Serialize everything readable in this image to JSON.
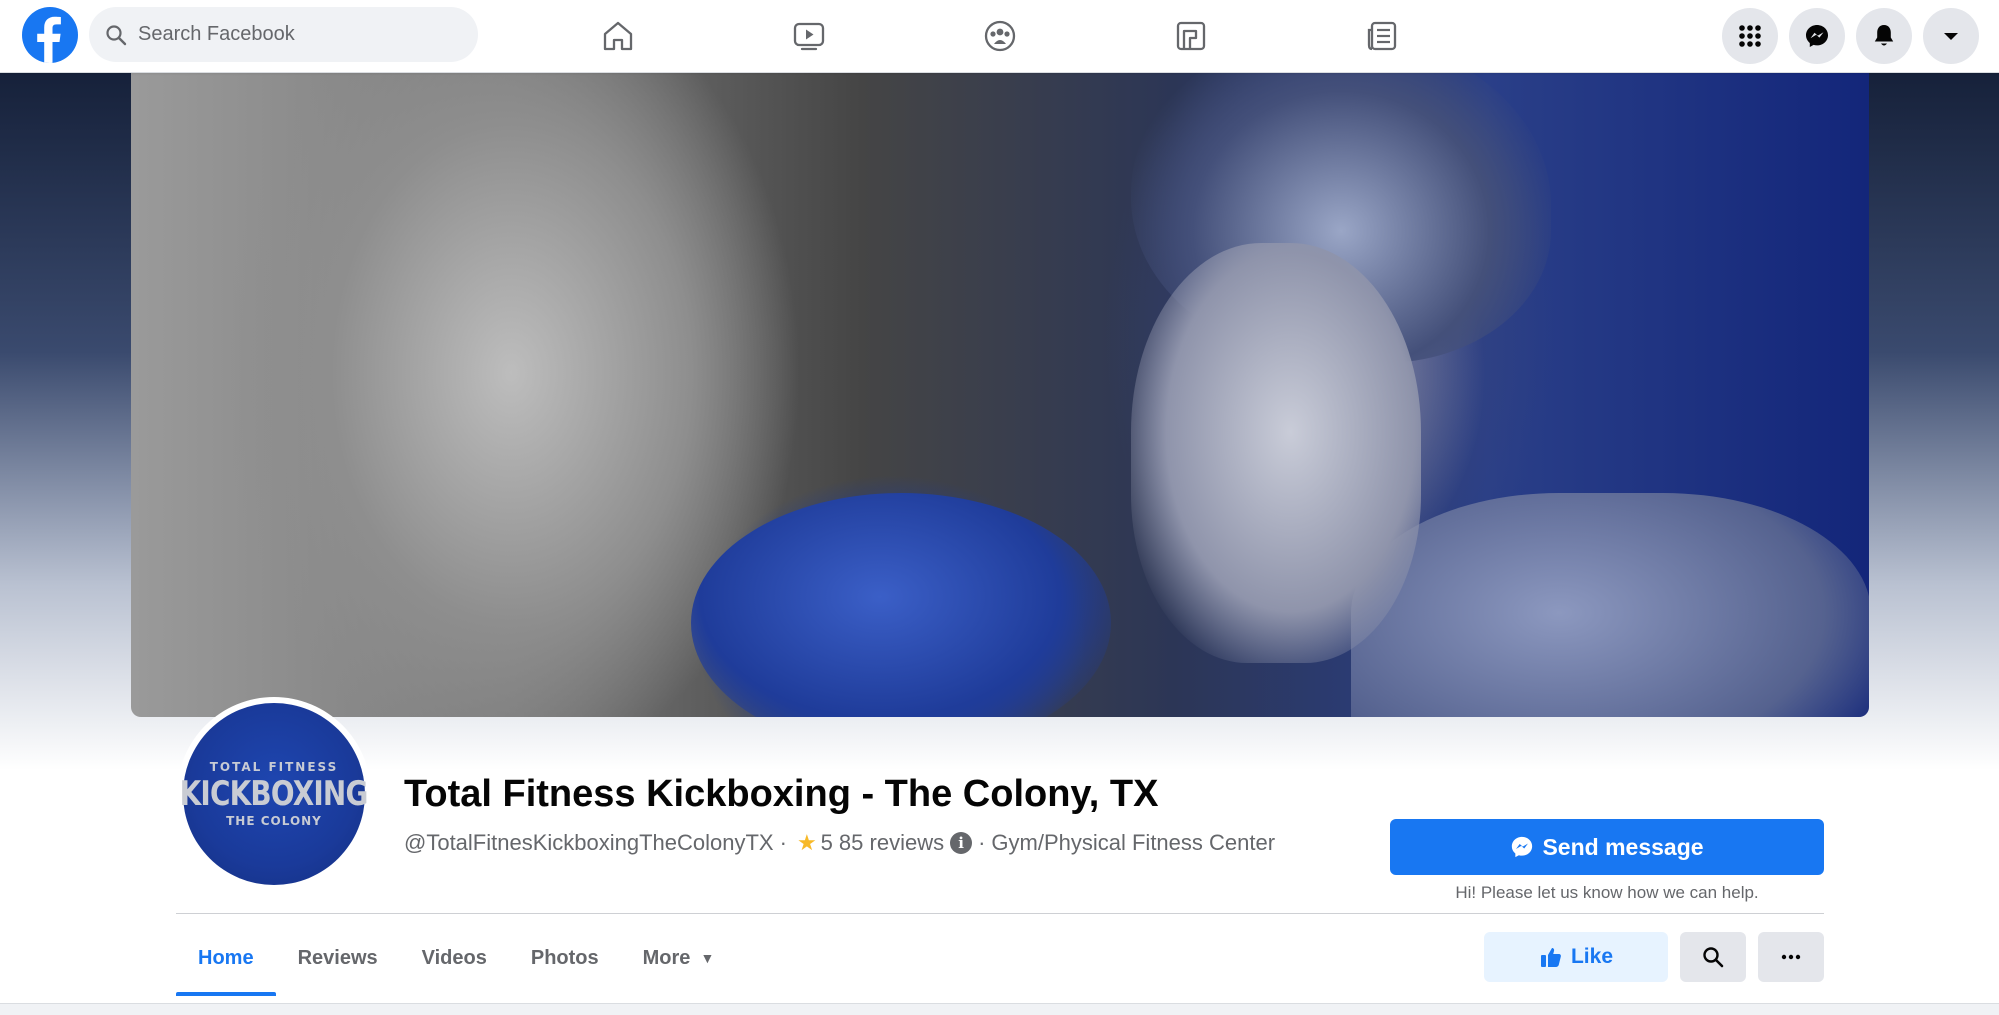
{
  "topbar": {
    "search_placeholder": "Search Facebook",
    "nav_icons": [
      "home-icon",
      "watch-icon",
      "groups-icon",
      "gaming-icon",
      "news-icon"
    ],
    "right_icons": [
      "menu-grid-icon",
      "messenger-icon",
      "notifications-icon",
      "account-caret-icon"
    ]
  },
  "page": {
    "title": "Total Fitness Kickboxing - The Colony, TX",
    "handle": "@TotalFitnesKickboxingTheColonyTX",
    "separator": "·",
    "rating": "5",
    "reviews": "85 reviews",
    "category": "Gym/Physical Fitness Center",
    "avatar": {
      "line1": "TOTAL FITNESS",
      "line2": "KICKBOXING",
      "line3": "THE COLONY"
    }
  },
  "actions": {
    "send_message": "Send message",
    "send_sub": "Hi! Please let us know how we can help.",
    "like": "Like",
    "more_dots": "···"
  },
  "tabs": [
    {
      "label": "Home",
      "active": true
    },
    {
      "label": "Reviews",
      "active": false
    },
    {
      "label": "Videos",
      "active": false
    },
    {
      "label": "Photos",
      "active": false
    },
    {
      "label": "More",
      "active": false
    }
  ],
  "colors": {
    "brand": "#1877f2",
    "rating_star": "#f7b928",
    "secondary_text": "#65676b"
  }
}
